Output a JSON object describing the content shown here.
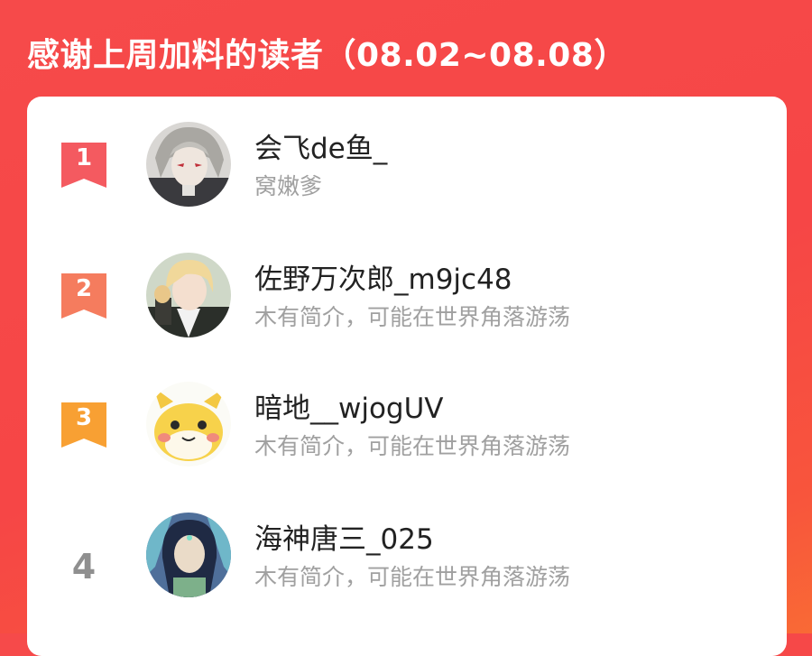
{
  "header": {
    "title": "感谢上周加料的读者（08.02~08.08）"
  },
  "readers": [
    {
      "rank": "1",
      "name": "会飞de鱼_",
      "bio": "窝嫩爹",
      "badge_color": "#f45a60",
      "avatar": "grey-haired-anime-character"
    },
    {
      "rank": "2",
      "name": "佐野万次郎_m9jc48",
      "bio": "木有简介，可能在世界角落游荡",
      "badge_color": "#f57c5e",
      "avatar": "blonde-anime-character"
    },
    {
      "rank": "3",
      "name": "暗地__wjogUV",
      "bio": "木有简介，可能在世界角落游荡",
      "badge_color": "#f8a033",
      "avatar": "yellow-cartoon-creature"
    },
    {
      "rank": "4",
      "name": "海神唐三_025",
      "bio": "木有简介，可能在世界角落游荡",
      "avatar": "fantasy-warrior-character"
    }
  ],
  "colors": {
    "background": "#f64a4a",
    "card": "#ffffff",
    "name": "#222222",
    "bio": "#a0a0a0",
    "plain_rank": "#8f8f8f"
  }
}
